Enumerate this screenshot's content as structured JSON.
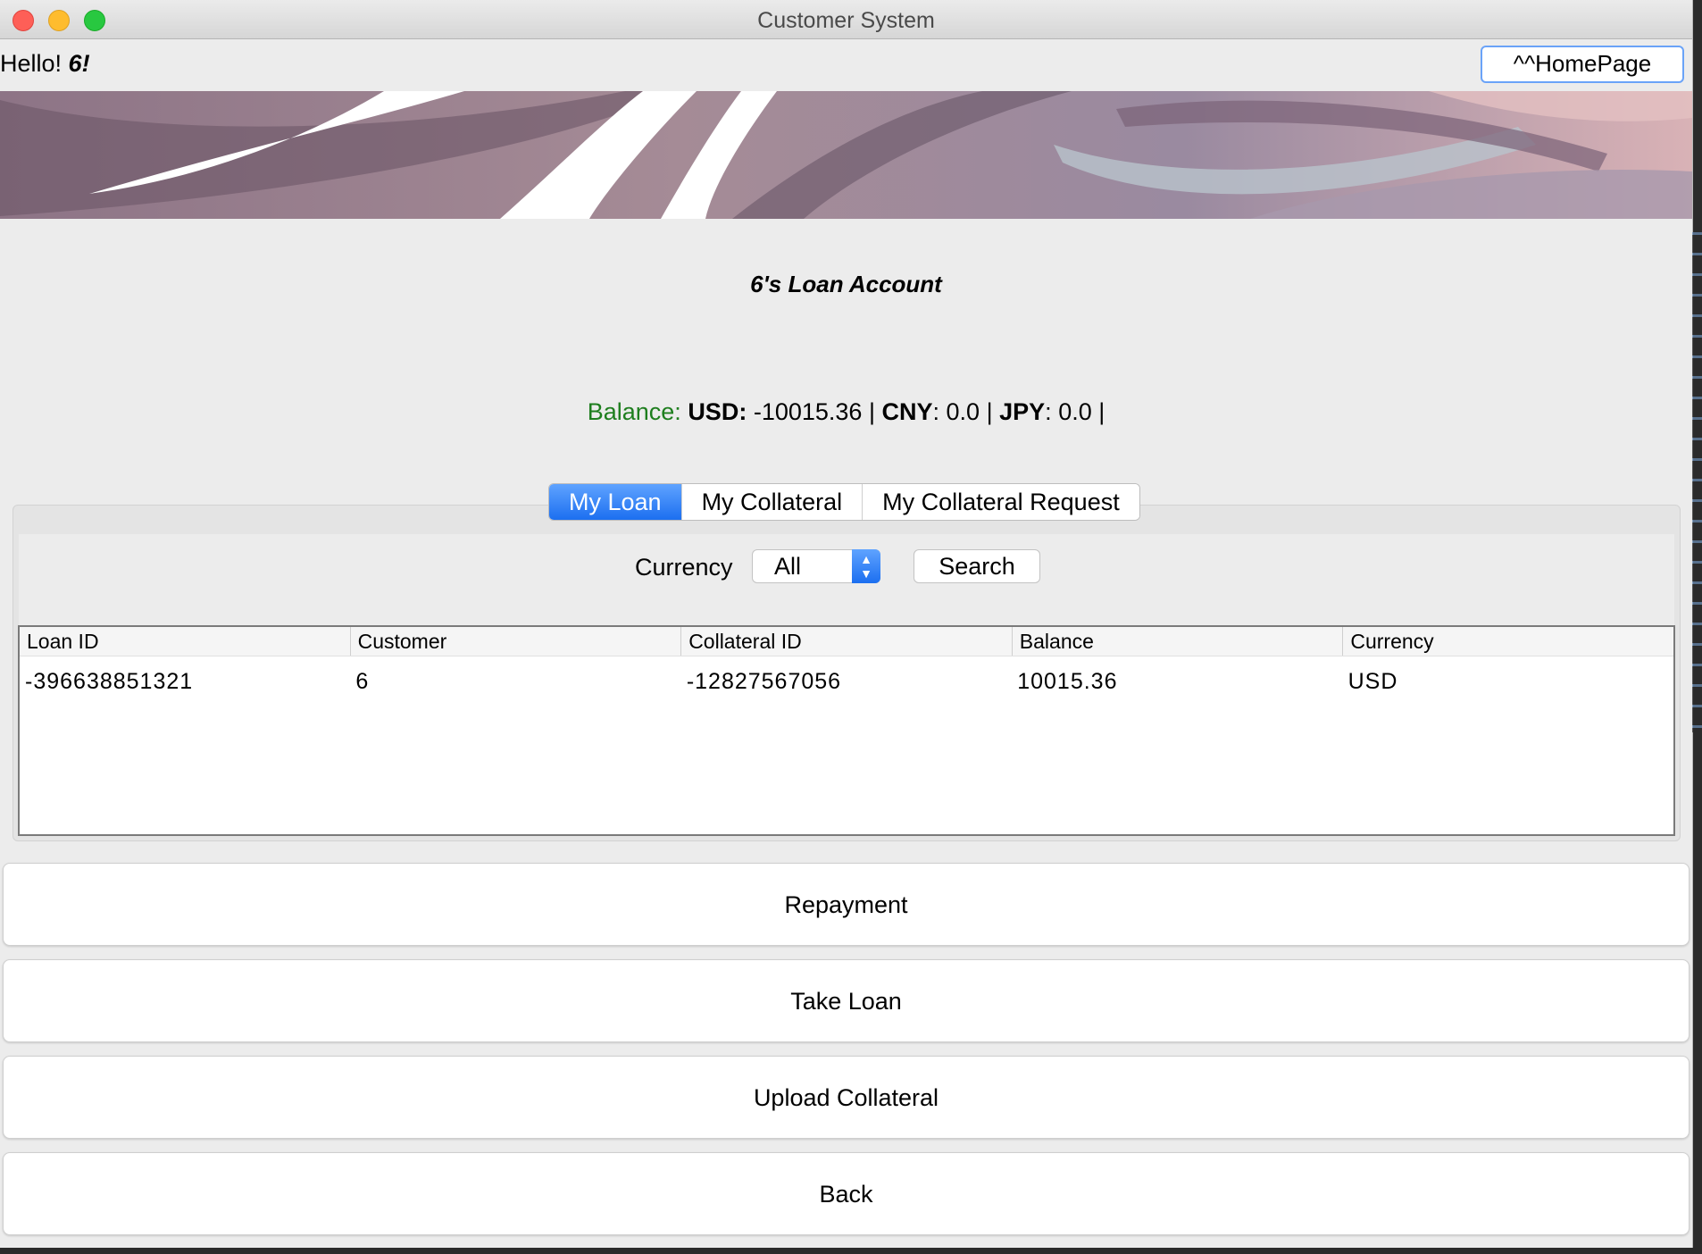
{
  "window": {
    "title": "Customer System"
  },
  "header": {
    "greeting_prefix": "Hello!",
    "user_name": "6!",
    "home_button": "^^HomePage"
  },
  "account": {
    "title": "6's Loan Account",
    "balance_label": "Balance:",
    "usd_label": "USD:",
    "usd_value": "-10015.36",
    "cny_label": "CNY",
    "cny_value": "0.0",
    "jpy_label": "JPY",
    "jpy_value": "0.0",
    "separator": "|"
  },
  "tabs": [
    {
      "label": "My Loan",
      "active": true
    },
    {
      "label": "My Collateral",
      "active": false
    },
    {
      "label": "My Collateral Request",
      "active": false
    }
  ],
  "filter": {
    "currency_label": "Currency",
    "currency_selected": "All",
    "search_button": "Search"
  },
  "table": {
    "columns": [
      "Loan ID",
      "Customer",
      "Collateral ID",
      "Balance",
      "Currency"
    ],
    "rows": [
      [
        "-396638851321",
        "6",
        "-12827567056",
        "10015.36",
        "USD"
      ]
    ]
  },
  "actions": {
    "repayment": "Repayment",
    "take_loan": "Take Loan",
    "upload_collateral": "Upload Collateral",
    "back": "Back"
  },
  "colors": {
    "accent": "#1c6ff0",
    "balance_label": "#1e7e1e",
    "close": "#fe5f57",
    "minimize": "#febc2e",
    "maximize": "#28c840"
  }
}
